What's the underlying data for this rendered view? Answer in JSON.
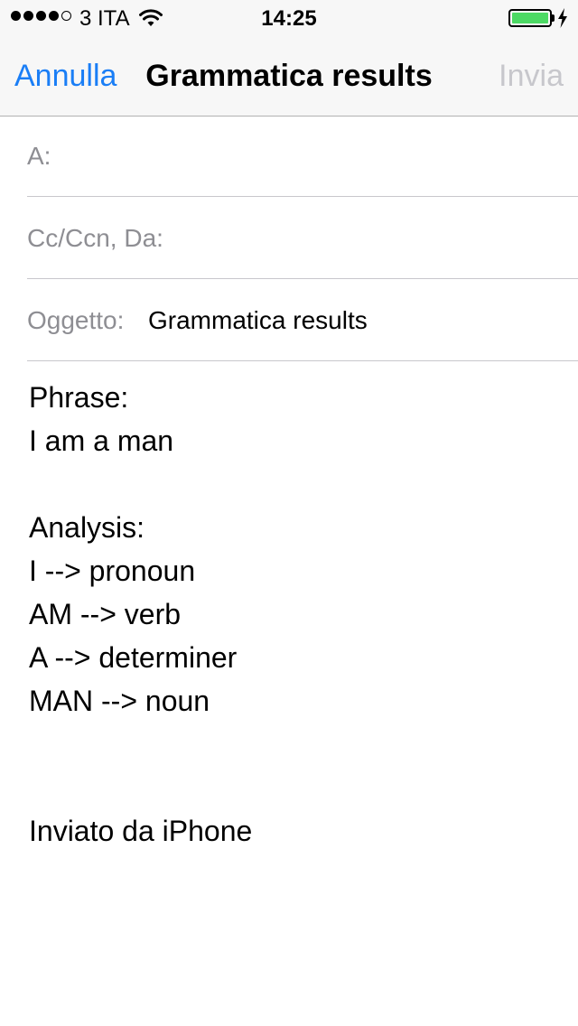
{
  "status_bar": {
    "carrier": "3 ITA",
    "time": "14:25",
    "signal_strength": "4 of 5",
    "battery_level": 1.0,
    "battery_color": "#4cd964",
    "icons": [
      "signal-dots-icon",
      "wifi-icon",
      "battery-icon",
      "charging-bolt-icon"
    ]
  },
  "nav": {
    "cancel_label": "Annulla",
    "title": "Grammatica results",
    "send_label": "Invia"
  },
  "fields": {
    "to_label": "A:",
    "cc_label": "Cc/Ccn, Da:",
    "subject_label": "Oggetto:",
    "subject_value": "Grammatica results"
  },
  "body": {
    "lines": [
      "Phrase:",
      "I am a man",
      "",
      "Analysis:",
      "I --> pronoun",
      "AM --> verb",
      "A --> determiner",
      "MAN --> noun",
      "",
      "",
      "Inviato da iPhone"
    ]
  },
  "colors": {
    "accent": "#1a7ef6",
    "disabled": "#c7c7cc",
    "label_gray": "#8e8e93"
  }
}
